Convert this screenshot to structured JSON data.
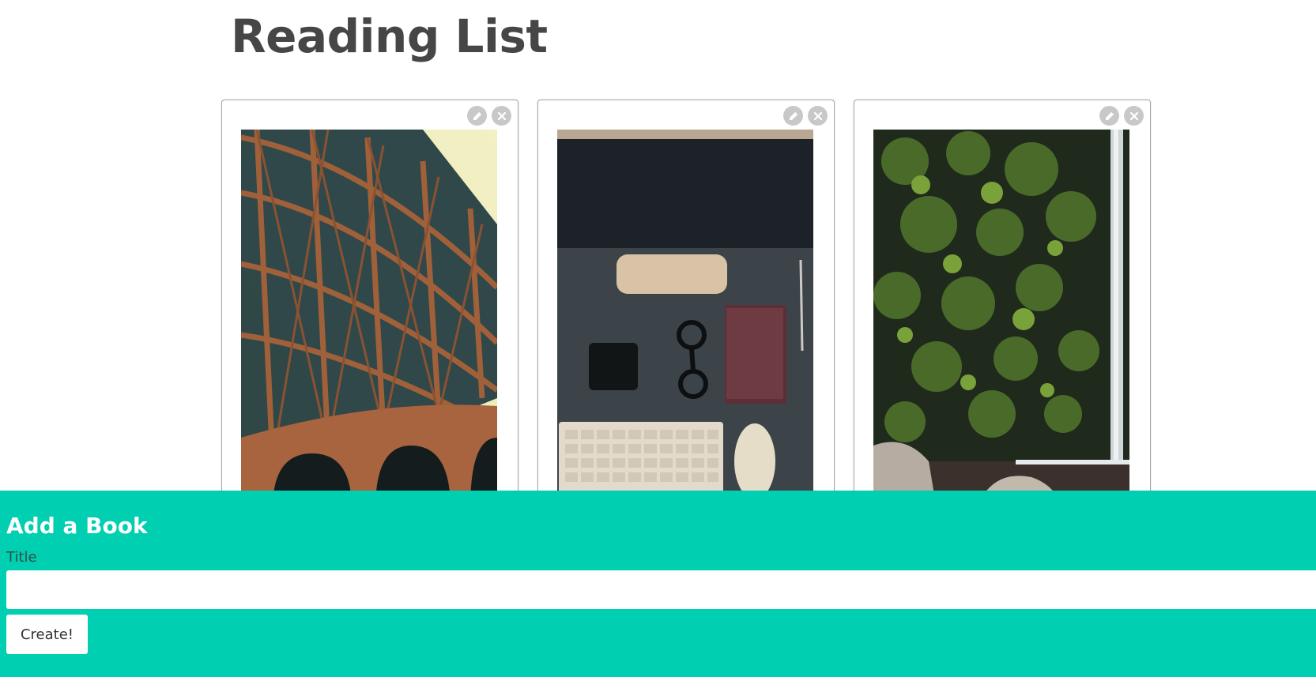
{
  "page_title": "Reading List",
  "books": [
    {
      "cover_icon": "bridge-photo",
      "edit_icon": "pencil-icon",
      "delete_icon": "close-icon"
    },
    {
      "cover_icon": "desk-photo",
      "edit_icon": "pencil-icon",
      "delete_icon": "close-icon"
    },
    {
      "cover_icon": "waterfall-photo",
      "edit_icon": "pencil-icon",
      "delete_icon": "close-icon"
    }
  ],
  "add_form": {
    "heading": "Add a Book",
    "title_label": "Title",
    "title_value": "",
    "create_label": "Create!"
  },
  "colors": {
    "accent": "#00cfb1",
    "title_text": "#464646",
    "icon_bg": "#c8c8c8"
  }
}
